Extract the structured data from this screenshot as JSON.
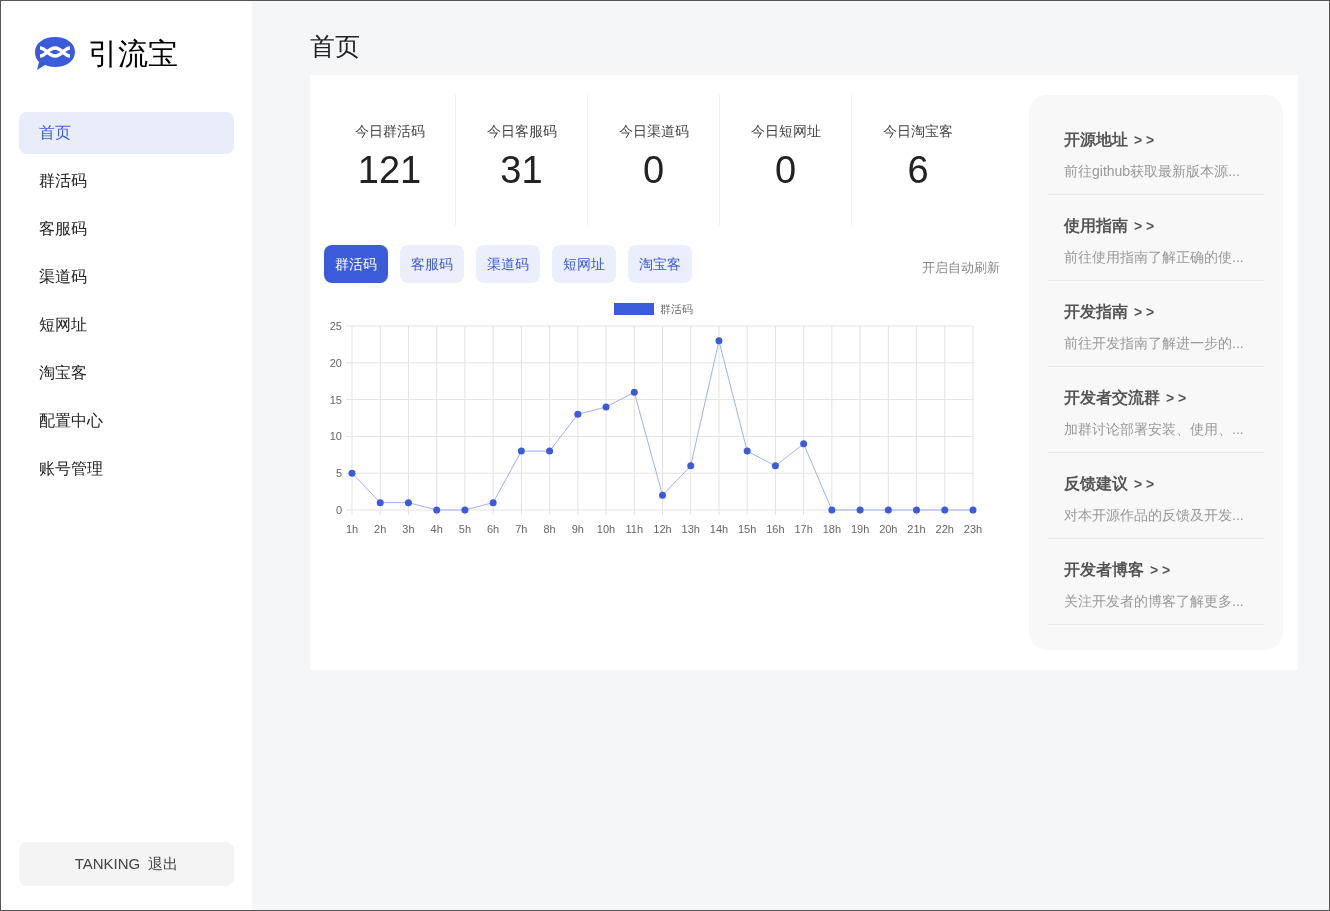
{
  "brand": {
    "name": "引流宝"
  },
  "sidebar": {
    "items": [
      {
        "label": "首页",
        "selected": true
      },
      {
        "label": "群活码",
        "selected": false
      },
      {
        "label": "客服码",
        "selected": false
      },
      {
        "label": "渠道码",
        "selected": false
      },
      {
        "label": "短网址",
        "selected": false
      },
      {
        "label": "淘宝客",
        "selected": false
      },
      {
        "label": "配置中心",
        "selected": false
      },
      {
        "label": "账号管理",
        "selected": false
      }
    ],
    "user": {
      "name": "TANKING",
      "logout": "退出"
    }
  },
  "page_title": "首页",
  "stats": [
    {
      "label": "今日群活码",
      "value": "121"
    },
    {
      "label": "今日客服码",
      "value": "31"
    },
    {
      "label": "今日渠道码",
      "value": "0"
    },
    {
      "label": "今日短网址",
      "value": "0"
    },
    {
      "label": "今日淘宝客",
      "value": "6"
    }
  ],
  "chart_tabs": [
    {
      "label": "群活码",
      "selected": true
    },
    {
      "label": "客服码",
      "selected": false
    },
    {
      "label": "渠道码",
      "selected": false
    },
    {
      "label": "短网址",
      "selected": false
    },
    {
      "label": "淘宝客",
      "selected": false
    }
  ],
  "auto_refresh": "开启自动刷新",
  "chart_data": {
    "type": "line",
    "categories": [
      "1h",
      "2h",
      "3h",
      "4h",
      "5h",
      "6h",
      "7h",
      "8h",
      "9h",
      "10h",
      "11h",
      "12h",
      "13h",
      "14h",
      "15h",
      "16h",
      "17h",
      "18h",
      "19h",
      "20h",
      "21h",
      "22h",
      "23h"
    ],
    "ylim": [
      0,
      25
    ],
    "grid": true,
    "yticks": [
      0,
      5,
      10,
      15,
      20,
      25
    ],
    "series": [
      {
        "name": "群活码",
        "color": "#3b5bdb",
        "marker": "circle",
        "values": [
          5,
          1,
          1,
          0,
          0,
          1,
          8,
          8,
          13,
          14,
          16,
          2,
          6,
          23,
          8,
          6,
          9,
          0,
          0,
          0,
          0,
          0,
          0
        ]
      }
    ]
  },
  "links": [
    {
      "title": "开源地址",
      "arrow": "> >",
      "desc": "前往github获取最新版本源..."
    },
    {
      "title": "使用指南",
      "arrow": "> >",
      "desc": "前往使用指南了解正确的使..."
    },
    {
      "title": "开发指南",
      "arrow": "> >",
      "desc": "前往开发指南了解进一步的..."
    },
    {
      "title": "开发者交流群",
      "arrow": "> >",
      "desc": "加群讨论部署安装、使用、..."
    },
    {
      "title": "反馈建议",
      "arrow": "> >",
      "desc": "对本开源作品的反馈及开发..."
    },
    {
      "title": "开发者博客",
      "arrow": "> >",
      "desc": "关注开发者的博客了解更多..."
    }
  ]
}
